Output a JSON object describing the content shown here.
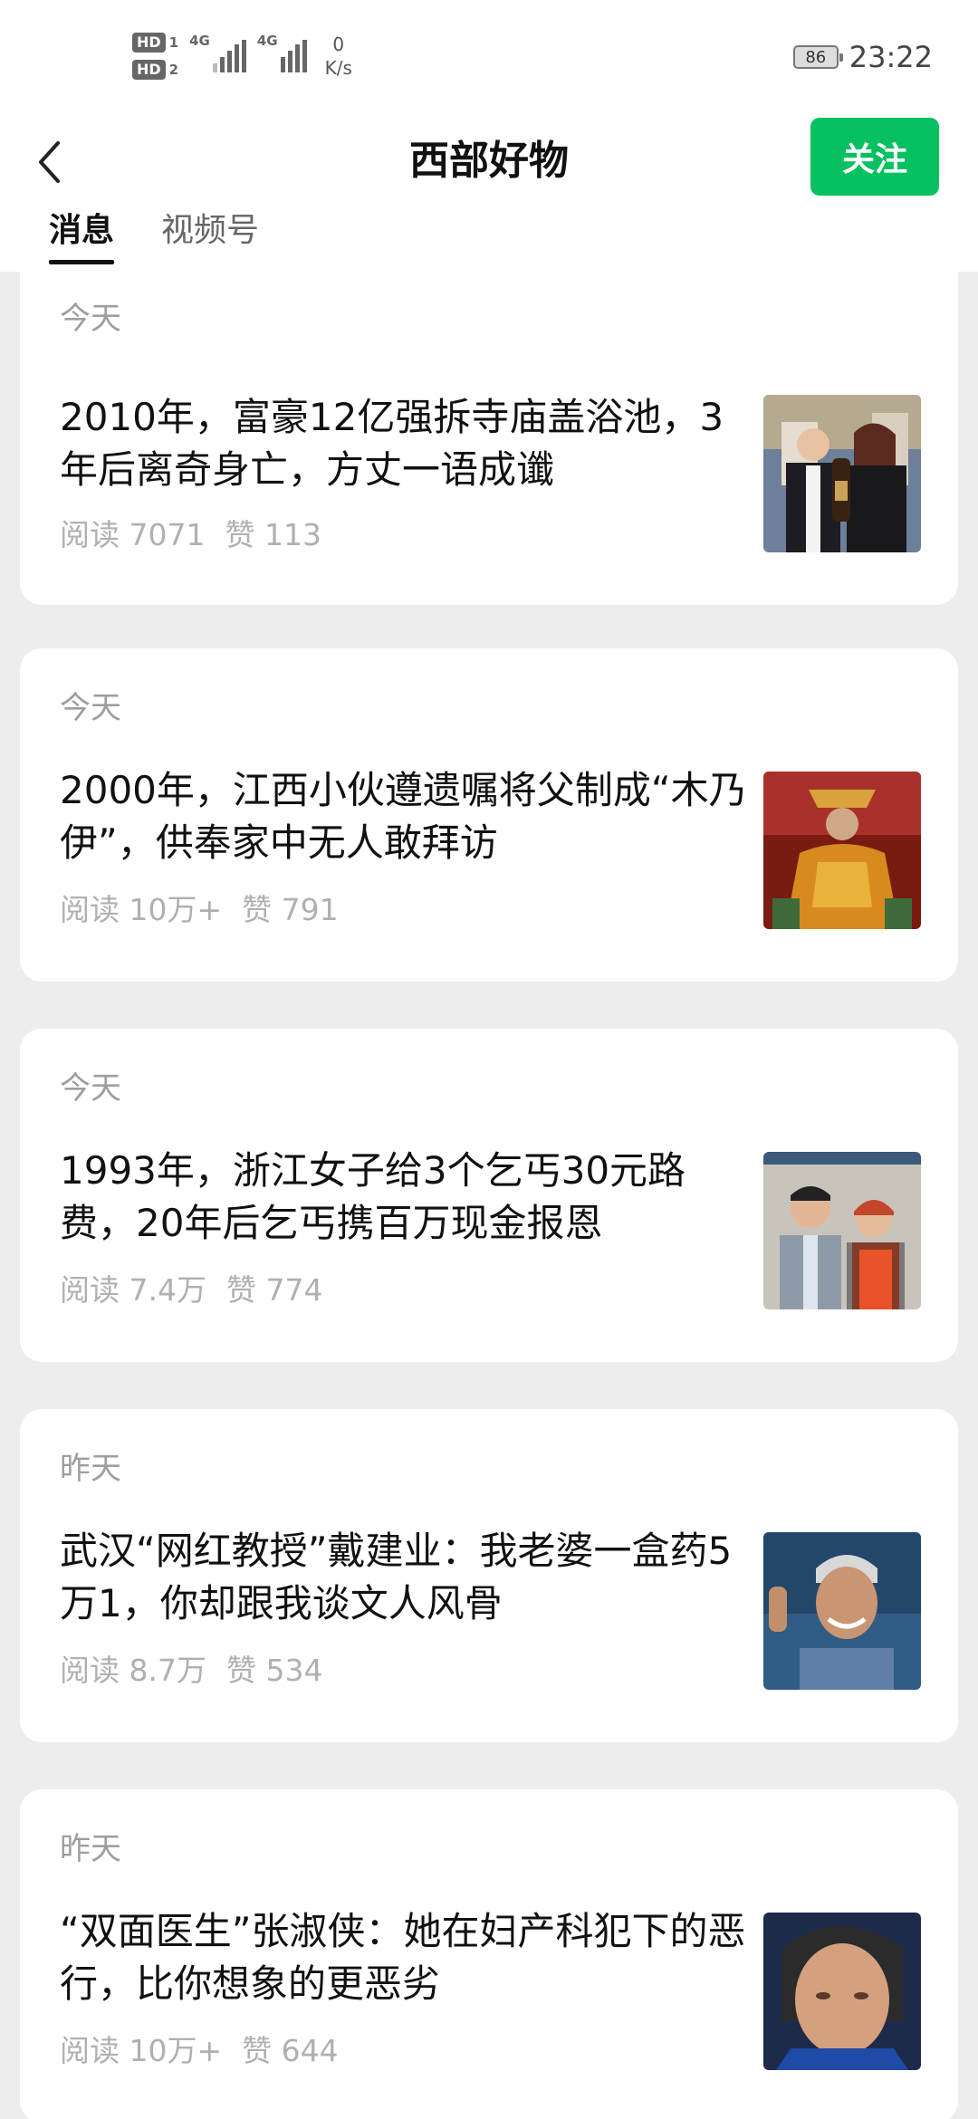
{
  "statusbar": {
    "sim1": "HD",
    "sim1_index": "1",
    "sim2": "HD",
    "sim2_index": "2",
    "net1": "4G",
    "net2": "4G",
    "speed_value": "0",
    "speed_unit": "K/s",
    "battery": "86",
    "time": "23:22"
  },
  "header": {
    "title": "西部好物",
    "follow_label": "关注",
    "tabs": [
      {
        "label": "消息",
        "active": true
      },
      {
        "label": "视频号",
        "active": false
      }
    ]
  },
  "articles": [
    {
      "date": "今天",
      "title": "2010年，富豪12亿强拆寺庙盖浴池，3年后离奇身亡，方丈一语成谶",
      "reads": "阅读 7071",
      "likes": "赞 113"
    },
    {
      "date": "今天",
      "title": "2000年，江西小伙遵遗嘱将父制成“木乃伊”，供奉家中无人敢拜访",
      "reads": "阅读 10万+",
      "likes": "赞 791"
    },
    {
      "date": "今天",
      "title": "1993年，浙江女子给3个乞丐30元路费，20年后乞丐携百万现金报恩",
      "reads": "阅读 7.4万",
      "likes": "赞 774"
    },
    {
      "date": "昨天",
      "title": "武汉“网红教授”戴建业：我老婆一盒药5万1，你却跟我谈文人风骨",
      "reads": "阅读 8.7万",
      "likes": "赞 534"
    },
    {
      "date": "昨天",
      "title": "“双面医生”张淑侠：她在妇产科犯下的恶行，比你想象的更恶劣",
      "reads": "阅读 10万+",
      "likes": "赞 644"
    }
  ]
}
